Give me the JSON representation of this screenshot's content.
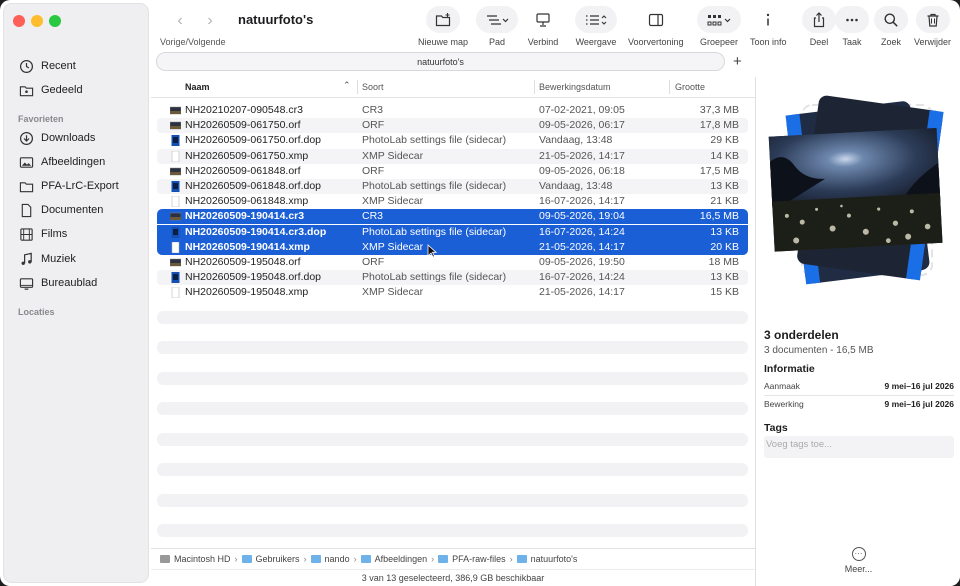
{
  "window": {
    "title": "natuurfoto's"
  },
  "toolbar": {
    "nav_label": "Vorige/Volgende",
    "buttons": [
      {
        "label": "Nieuwe map",
        "icon": "new-folder-icon"
      },
      {
        "label": "Pad",
        "icon": "path-icon"
      },
      {
        "label": "Verbind",
        "icon": "connect-icon"
      },
      {
        "label": "Weergave",
        "icon": "view-icon"
      },
      {
        "label": "Voorvertoning",
        "icon": "preview-icon"
      },
      {
        "label": "Groepeer",
        "icon": "group-icon"
      },
      {
        "label": "Toon info",
        "icon": "info-icon"
      },
      {
        "label": "Deel",
        "icon": "share-icon"
      },
      {
        "label": "Taak",
        "icon": "more-icon"
      },
      {
        "label": "Zoek",
        "icon": "search-icon"
      },
      {
        "label": "Verwijder",
        "icon": "trash-icon"
      }
    ]
  },
  "tab": {
    "title": "natuurfoto's",
    "add": "+"
  },
  "sidebar": {
    "top": [
      {
        "label": "Recent",
        "icon": "clock-icon"
      },
      {
        "label": "Gedeeld",
        "icon": "shared-folder-icon"
      }
    ],
    "favorites_header": "Favorieten",
    "favorites": [
      {
        "label": "Downloads",
        "icon": "download-icon"
      },
      {
        "label": "Afbeeldingen",
        "icon": "photo-icon"
      },
      {
        "label": "PFA-LrC-Export",
        "icon": "folder-icon"
      },
      {
        "label": "Documenten",
        "icon": "document-icon"
      },
      {
        "label": "Films",
        "icon": "film-icon"
      },
      {
        "label": "Muziek",
        "icon": "music-icon"
      },
      {
        "label": "Bureaublad",
        "icon": "desktop-icon"
      }
    ],
    "locations_header": "Locaties"
  },
  "columns": {
    "name": "Naam",
    "kind": "Soort",
    "date": "Bewerkingsdatum",
    "size": "Grootte"
  },
  "files": [
    {
      "name": "NH20210207-090548.cr3",
      "kind": "CR3",
      "date": "07-02-2021, 09:05",
      "size": "37,3 MB",
      "icon": "raw-thumb-icon",
      "selected": false
    },
    {
      "name": "NH20260509-061750.orf",
      "kind": "ORF",
      "date": "09-05-2026, 06:17",
      "size": "17,8 MB",
      "icon": "raw-thumb-icon",
      "selected": false
    },
    {
      "name": "NH20260509-061750.orf.dop",
      "kind": "PhotoLab settings file (sidecar)",
      "date": "Vandaag, 13:48",
      "size": "29 KB",
      "icon": "dop-file-icon",
      "selected": false
    },
    {
      "name": "NH20260509-061750.xmp",
      "kind": "XMP Sidecar",
      "date": "21-05-2026, 14:17",
      "size": "14 KB",
      "icon": "xmp-file-icon",
      "selected": false
    },
    {
      "name": "NH20260509-061848.orf",
      "kind": "ORF",
      "date": "09-05-2026, 06:18",
      "size": "17,5 MB",
      "icon": "raw-thumb-icon",
      "selected": false
    },
    {
      "name": "NH20260509-061848.orf.dop",
      "kind": "PhotoLab settings file (sidecar)",
      "date": "Vandaag, 13:48",
      "size": "13 KB",
      "icon": "dop-file-icon",
      "selected": false
    },
    {
      "name": "NH20260509-061848.xmp",
      "kind": "XMP Sidecar",
      "date": "16-07-2026, 14:17",
      "size": "21 KB",
      "icon": "xmp-file-icon",
      "selected": false
    },
    {
      "name": "NH20260509-190414.cr3",
      "kind": "CR3",
      "date": "09-05-2026, 19:04",
      "size": "16,5 MB",
      "icon": "raw-thumb-icon",
      "selected": true
    },
    {
      "name": "NH20260509-190414.cr3.dop",
      "kind": "PhotoLab settings file (sidecar)",
      "date": "16-07-2026, 14:24",
      "size": "13 KB",
      "icon": "dop-file-icon",
      "selected": true
    },
    {
      "name": "NH20260509-190414.xmp",
      "kind": "XMP Sidecar",
      "date": "21-05-2026, 14:17",
      "size": "20 KB",
      "icon": "xmp-file-icon",
      "selected": true
    },
    {
      "name": "NH20260509-195048.orf",
      "kind": "ORF",
      "date": "09-05-2026, 19:50",
      "size": "18 MB",
      "icon": "raw-thumb-icon",
      "selected": false
    },
    {
      "name": "NH20260509-195048.orf.dop",
      "kind": "PhotoLab settings file (sidecar)",
      "date": "16-07-2026, 14:24",
      "size": "13 KB",
      "icon": "dop-file-icon",
      "selected": false
    },
    {
      "name": "NH20260509-195048.xmp",
      "kind": "XMP Sidecar",
      "date": "21-05-2026, 14:17",
      "size": "15 KB",
      "icon": "xmp-file-icon",
      "selected": false
    }
  ],
  "path": [
    "Macintosh HD",
    "Gebruikers",
    "nando",
    "Afbeeldingen",
    "PFA-raw-files",
    "natuurfoto's"
  ],
  "status": "3 van 13 geselecteerd, 386,9 GB beschikbaar",
  "inspector": {
    "count": "3 onderdelen",
    "summary": "3 documenten - 16,5 MB",
    "info_header": "Informatie",
    "created_label": "Aanmaak",
    "created_value": "9 mei–16 jul 2026",
    "modified_label": "Bewerking",
    "modified_value": "9 mei–16 jul 2026",
    "tags_header": "Tags",
    "tags_placeholder": "Voeg tags toe...",
    "more_label": "Meer..."
  },
  "colors": {
    "selection": "#1b5fd6",
    "accent_blue": "#1a6ee6"
  }
}
